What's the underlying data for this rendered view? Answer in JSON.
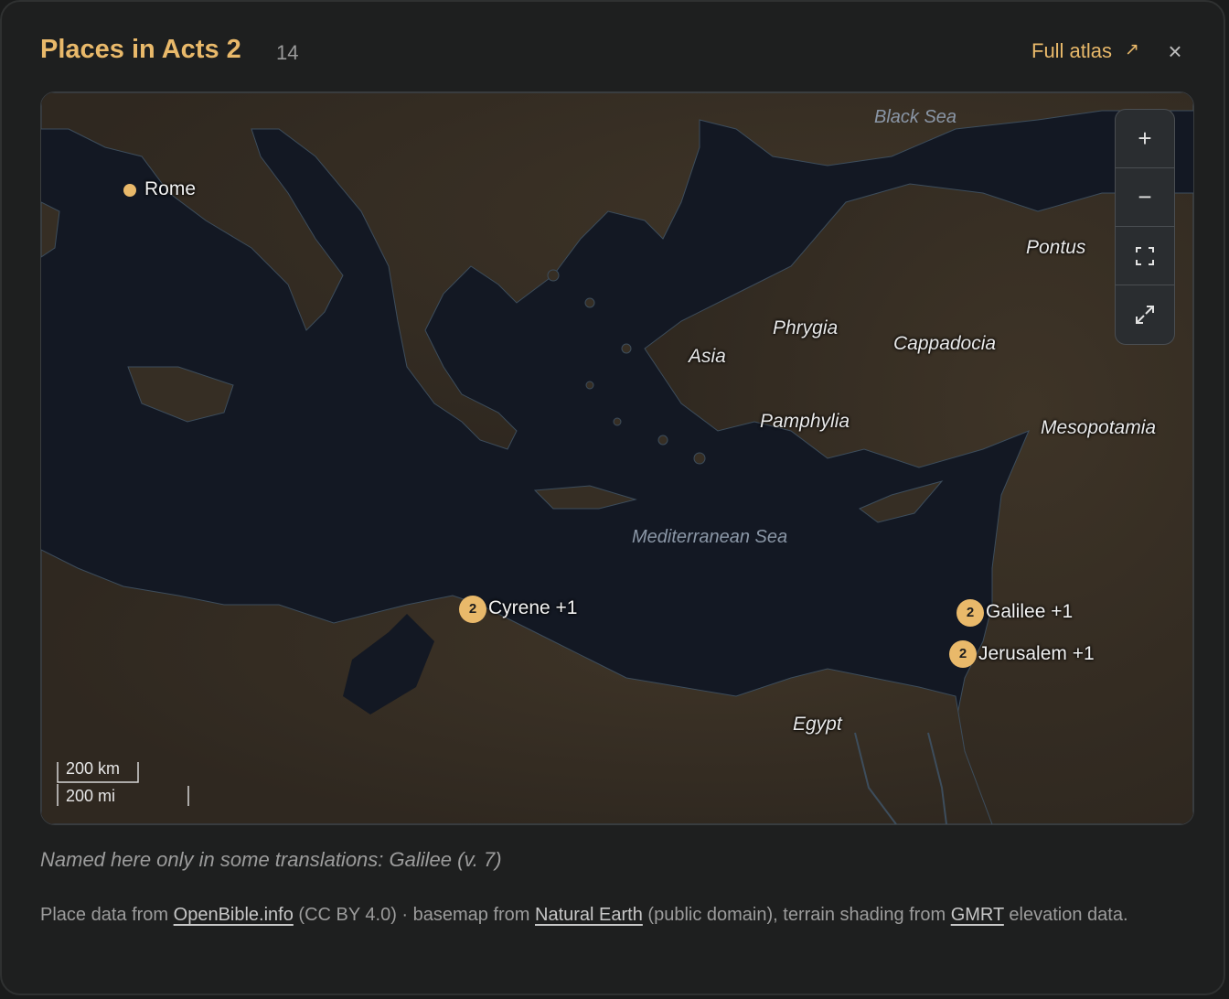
{
  "header": {
    "title": "Places in Acts 2",
    "count": "14",
    "atlas_link": "Full atlas",
    "atlas_icon": "external-link-icon",
    "close_icon": "×"
  },
  "map": {
    "seas": {
      "black_sea": "Black Sea",
      "mediterranean": "Mediterranean Sea"
    },
    "regions": {
      "pontus": "Pontus",
      "phrygia": "Phrygia",
      "cappadocia": "Cappadocia",
      "asia": "Asia",
      "pamphylia": "Pamphylia",
      "mesopotamia": "Mesopotamia",
      "egypt": "Egypt"
    },
    "places": {
      "rome": "Rome",
      "cyrene": {
        "count": "2",
        "label": "Cyrene +1"
      },
      "galilee": {
        "count": "2",
        "label": "Galilee +1"
      },
      "jerusalem": {
        "count": "2",
        "label": "Jerusalem +1"
      }
    },
    "controls": {
      "zoom_in": "+",
      "zoom_out": "−",
      "fit": "fit-bounds-icon",
      "fullscreen": "expand-icon"
    },
    "scale": {
      "km": "200 km",
      "mi": "200 mi"
    }
  },
  "note": "Named here only in some translations: Galilee (v. 7)",
  "credits": {
    "prefix": "Place data from",
    "openbible": "OpenBible.info",
    "license": "(CC BY 4.0) · basemap from",
    "natural_earth": "Natural Earth",
    "public_domain": "(public domain), terrain shading from",
    "gmrt": "GMRT",
    "suffix": "elevation data."
  },
  "colors": {
    "accent": "#e9b96a",
    "sea": "#131823",
    "land": "#3a3024"
  }
}
